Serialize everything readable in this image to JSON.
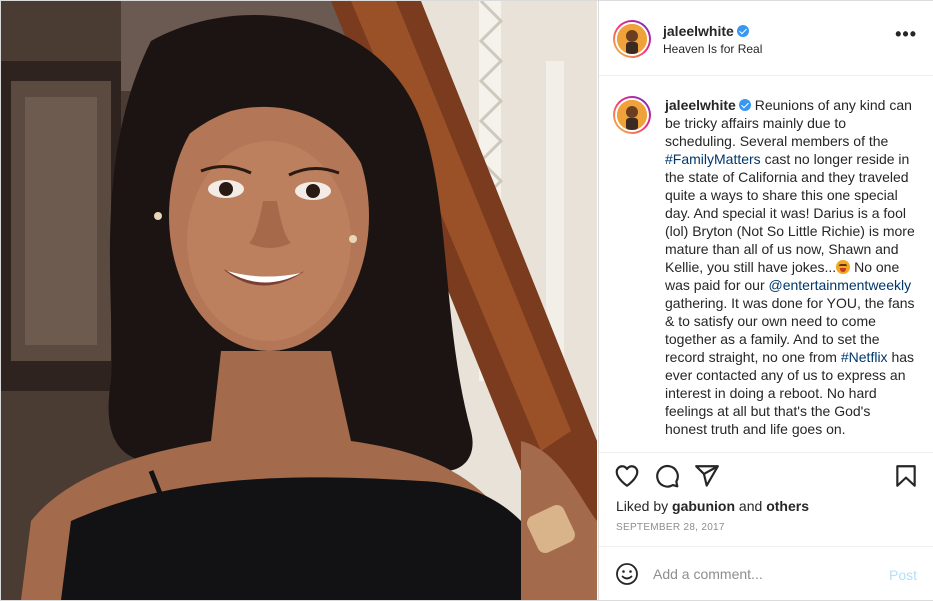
{
  "post": {
    "author": "jaleelwhite",
    "verified": true,
    "location": "Heaven Is for Real",
    "more_label": "•••"
  },
  "caption": {
    "author": "jaleelwhite",
    "text_1": " Reunions of any kind can be tricky affairs mainly due to scheduling. Several members of the ",
    "hashtag_1": "#FamilyMatters",
    "text_2": " cast no longer reside in the state of California and they traveled quite a ways to share this one special day. And special it was! Darius is a fool (lol) Bryton (Not So Little Richie) is more mature than all of us now, Shawn and Kellie, you still have jokes...",
    "text_3": " No one was paid for our ",
    "mention_1": "@entertainmentweekly",
    "text_4": " gathering. It was done for YOU, the fans & to satisfy our own need to come together as a family. And to set the record straight, no one from ",
    "hashtag_2": "#Netflix",
    "text_5": " has ever contacted any of us to express an interest in doing a reboot. No hard feelings at all but that's the God's honest truth and life goes on."
  },
  "engagement": {
    "liked_by_prefix": "Liked by ",
    "liked_by_user": "gabunion",
    "liked_by_and": " and ",
    "liked_by_others": "others",
    "date": "September 28, 2017"
  },
  "comment": {
    "placeholder": "Add a comment...",
    "post_label": "Post"
  },
  "icons": {
    "like": "heart-icon",
    "comment": "comment-icon",
    "share": "share-icon",
    "save": "bookmark-icon",
    "emoji": "emoji-icon",
    "more": "more-icon",
    "verified": "verified-icon"
  },
  "colors": {
    "link": "#00376b",
    "verified": "#3897f0",
    "post_button_disabled": "#b2dffc",
    "muted": "#8e8e8e"
  }
}
